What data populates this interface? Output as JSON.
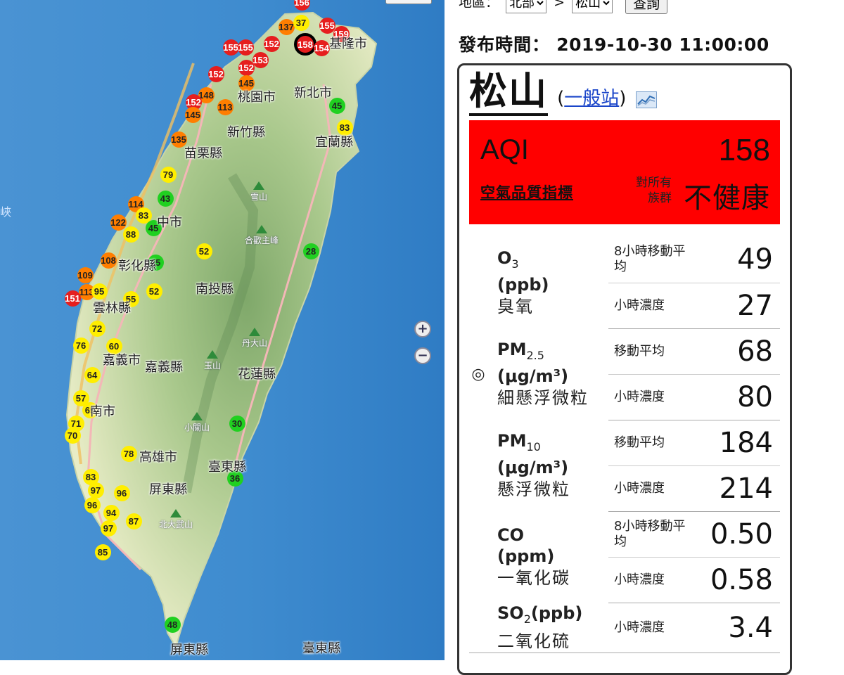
{
  "map": {
    "markers": [
      {
        "value": "156",
        "level": "red"
      },
      {
        "value": "137",
        "level": "orange"
      },
      {
        "value": "37",
        "level": "yellow"
      },
      {
        "value": "155",
        "level": "red"
      },
      {
        "value": "159",
        "level": "red"
      },
      {
        "value": "155",
        "level": "red"
      },
      {
        "value": "155",
        "level": "red"
      },
      {
        "value": "152",
        "level": "red"
      },
      {
        "value": "158",
        "level": "red"
      },
      {
        "value": "154",
        "level": "red"
      },
      {
        "value": "152",
        "level": "red"
      },
      {
        "value": "153",
        "level": "red"
      },
      {
        "value": "152",
        "level": "red"
      },
      {
        "value": "145",
        "level": "orange"
      },
      {
        "value": "148",
        "level": "orange"
      },
      {
        "value": "152",
        "level": "red"
      },
      {
        "value": "145",
        "level": "orange"
      },
      {
        "value": "113",
        "level": "orange"
      },
      {
        "value": "45",
        "level": "green"
      },
      {
        "value": "83",
        "level": "yellow"
      },
      {
        "value": "135",
        "level": "orange"
      },
      {
        "value": "79",
        "level": "yellow"
      },
      {
        "value": "43",
        "level": "green"
      },
      {
        "value": "114",
        "level": "orange"
      },
      {
        "value": "83",
        "level": "yellow"
      },
      {
        "value": "122",
        "level": "orange"
      },
      {
        "value": "88",
        "level": "yellow"
      },
      {
        "value": "45",
        "level": "green"
      },
      {
        "value": "52",
        "level": "yellow"
      },
      {
        "value": "28",
        "level": "green"
      },
      {
        "value": "108",
        "level": "orange"
      },
      {
        "value": "45",
        "level": "green"
      },
      {
        "value": "109",
        "level": "orange"
      },
      {
        "value": "113",
        "level": "orange"
      },
      {
        "value": "95",
        "level": "yellow"
      },
      {
        "value": "151",
        "level": "red"
      },
      {
        "value": "55",
        "level": "yellow"
      },
      {
        "value": "52",
        "level": "yellow"
      },
      {
        "value": "72",
        "level": "yellow"
      },
      {
        "value": "76",
        "level": "yellow"
      },
      {
        "value": "60",
        "level": "yellow"
      },
      {
        "value": "64",
        "level": "yellow"
      },
      {
        "value": "57",
        "level": "yellow"
      },
      {
        "value": "65",
        "level": "yellow"
      },
      {
        "value": "71",
        "level": "yellow"
      },
      {
        "value": "70",
        "level": "yellow"
      },
      {
        "value": "30",
        "level": "green"
      },
      {
        "value": "78",
        "level": "yellow"
      },
      {
        "value": "36",
        "level": "green"
      },
      {
        "value": "83",
        "level": "yellow"
      },
      {
        "value": "97",
        "level": "yellow"
      },
      {
        "value": "96",
        "level": "yellow"
      },
      {
        "value": "96",
        "level": "yellow"
      },
      {
        "value": "94",
        "level": "yellow"
      },
      {
        "value": "87",
        "level": "yellow"
      },
      {
        "value": "97",
        "level": "yellow"
      },
      {
        "value": "85",
        "level": "yellow"
      },
      {
        "value": "48",
        "level": "green"
      }
    ],
    "selected_marker_value": "158",
    "place_names": [
      "基隆市",
      "新北市",
      "桃園市",
      "新竹縣",
      "宜蘭縣",
      "苗栗縣",
      "中市",
      "彰化縣",
      "南投縣",
      "雲林縣",
      "嘉義市",
      "嘉義縣",
      "花蓮縣",
      "南市",
      "高雄市",
      "臺東縣",
      "屏東縣",
      "屏東縣",
      "臺東縣",
      "峽"
    ],
    "mountains": [
      "雪山",
      "合歡主峰",
      "丹大山",
      "玉山",
      "小關山",
      "北大武山"
    ],
    "level_colors": {
      "red": "#e61e1e",
      "orange": "#ff7e00",
      "yellow": "#ffee00",
      "green": "#20d020"
    },
    "zoom_in_label": "+",
    "zoom_out_label": "−"
  },
  "selector": {
    "region_label": "地區：",
    "region_value": "北部",
    "separator": ">",
    "station_value": "松山",
    "query_button": "查詢"
  },
  "publish": {
    "label": "發布時間：",
    "time": "2019-10-30 11:00:00"
  },
  "station": {
    "name": "松山",
    "type_open": "(",
    "type": "一般站",
    "type_close": ")"
  },
  "aqi": {
    "label": "AQI",
    "value": "158",
    "link_text": "空氣品質指標",
    "target": "對所有族群",
    "status": "不健康",
    "color": "#ff0000"
  },
  "pollutants": [
    {
      "symbol": "O",
      "sub": "3",
      "unit": "(ppb)",
      "zh": "臭氧",
      "main": false,
      "rows": [
        {
          "label": "8小時移動平均",
          "value": "49"
        },
        {
          "label": "小時濃度",
          "value": "27"
        }
      ]
    },
    {
      "symbol": "PM",
      "sub": "2.5",
      "unit": "(μg/m³)",
      "zh": "細懸浮微粒",
      "main": true,
      "rows": [
        {
          "label": "移動平均",
          "value": "68"
        },
        {
          "label": "小時濃度",
          "value": "80"
        }
      ]
    },
    {
      "symbol": "PM",
      "sub": "10",
      "unit": "(μg/m³)",
      "zh": "懸浮微粒",
      "main": false,
      "rows": [
        {
          "label": "移動平均",
          "value": "184"
        },
        {
          "label": "小時濃度",
          "value": "214"
        }
      ]
    },
    {
      "symbol": "CO",
      "sub": "",
      "unit": "(ppm)",
      "zh": "一氧化碳",
      "main": false,
      "rows": [
        {
          "label": "8小時移動平均",
          "value": "0.50"
        },
        {
          "label": "小時濃度",
          "value": "0.58"
        }
      ]
    },
    {
      "symbol": "SO",
      "sub": "2",
      "unit": "(ppb)",
      "zh": "二氧化硫",
      "main": false,
      "rows": [
        {
          "label": "小時濃度",
          "value": "3.4"
        }
      ]
    }
  ],
  "main_pollutant_mark": "◎"
}
